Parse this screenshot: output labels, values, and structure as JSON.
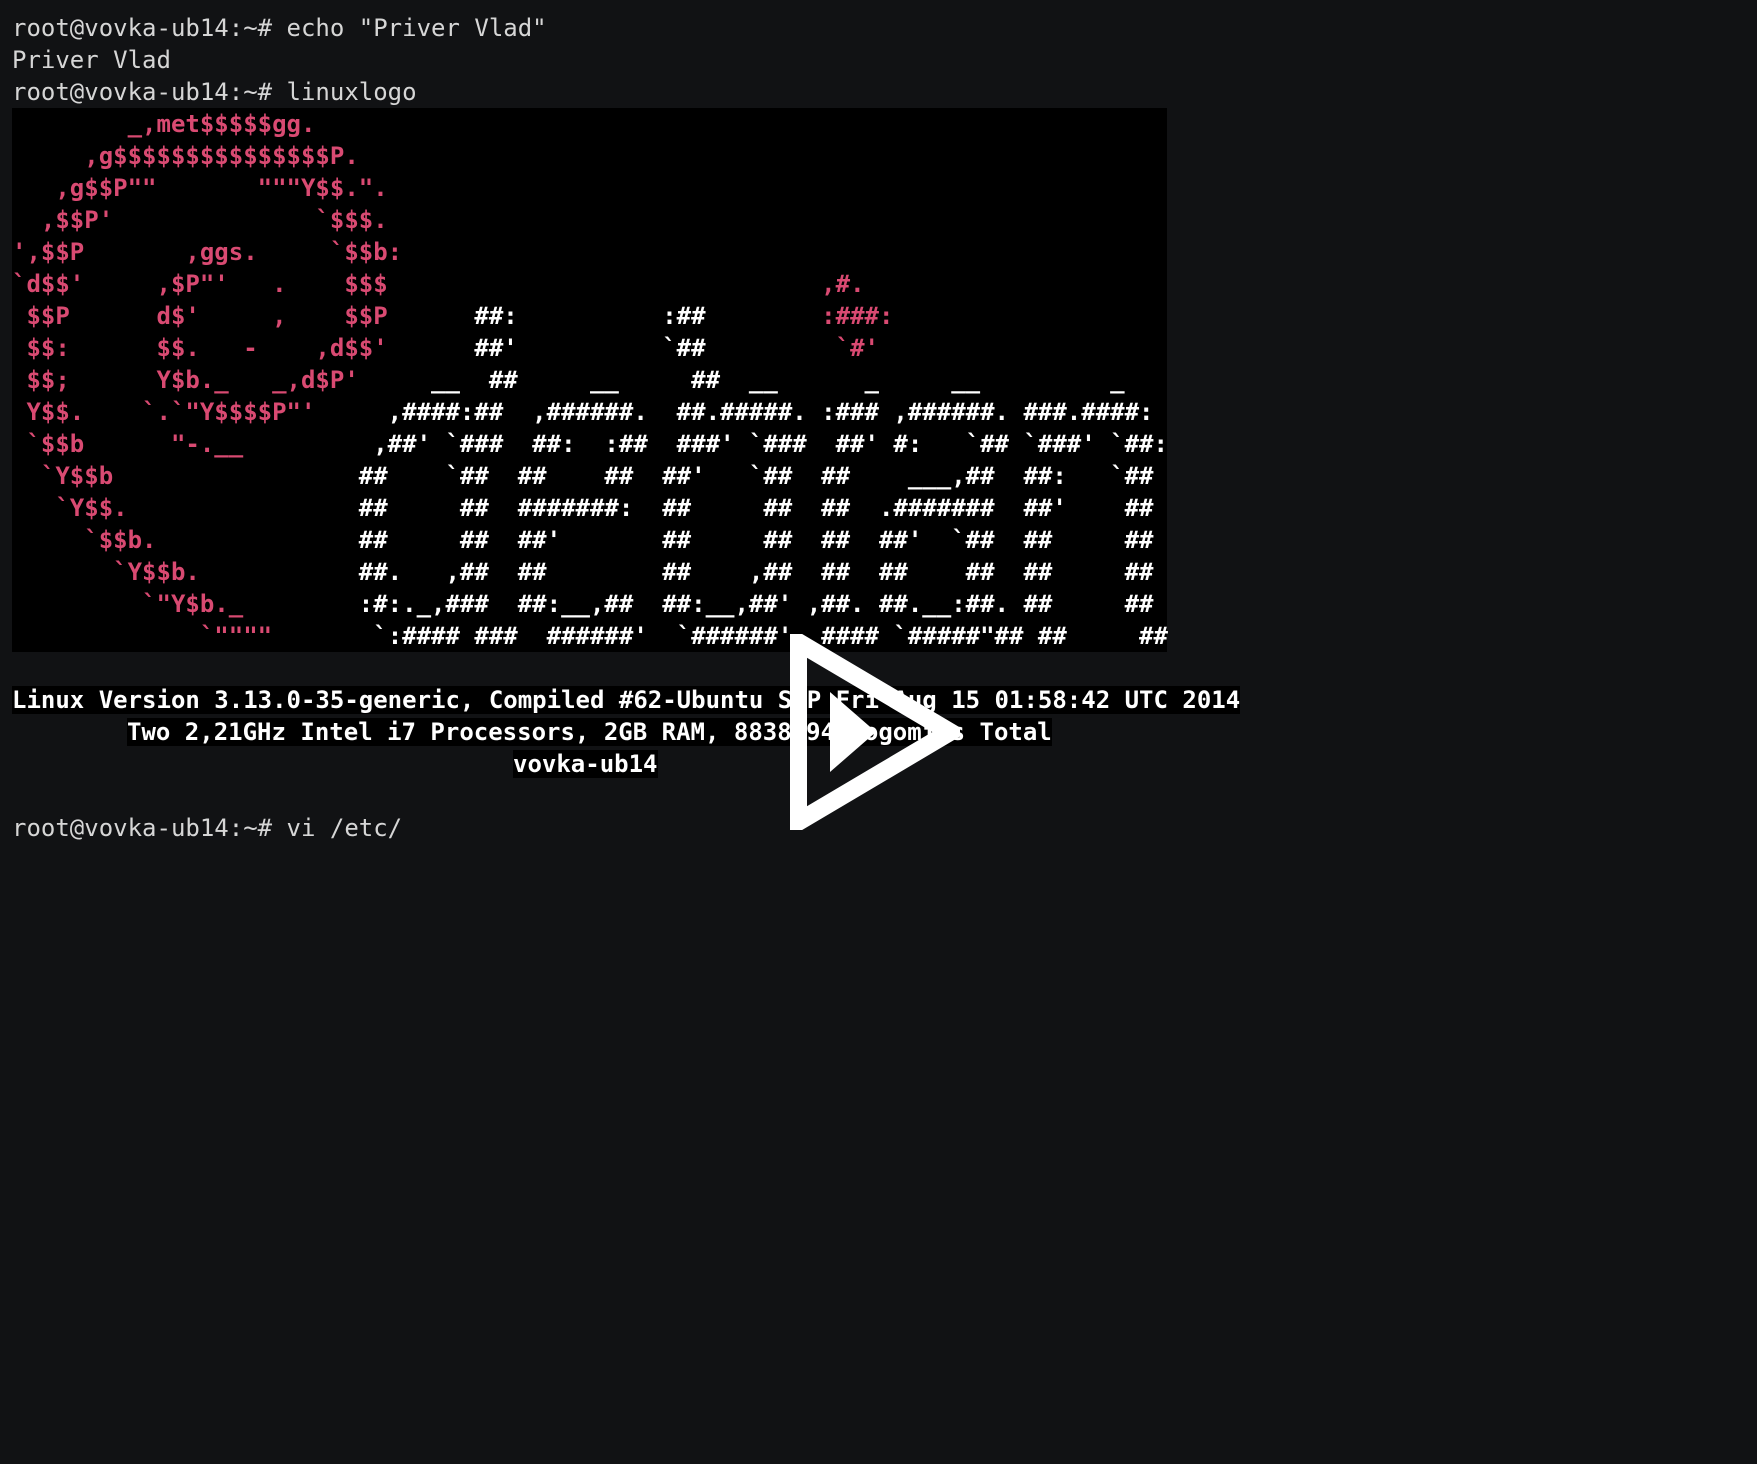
{
  "terminal": {
    "background": "#111214",
    "prompt": "root@vovka-ub14:~#",
    "lines": {
      "cmd1": "root@vovka-ub14:~# echo \"Priver Vlad\"",
      "out1": "Priver Vlad",
      "cmd2": "root@vovka-ub14:~# linuxlogo"
    },
    "logo": {
      "color_swirl": "#d94a72",
      "color_text": "#ffffff",
      "rows": [
        {
          "red": "        _,met$$$$$gg.",
          "white": ""
        },
        {
          "red": "     ,g$$$$$$$$$$$$$$$P.",
          "white": ""
        },
        {
          "red": "   ,g$$P\"\"       \"\"\"Y$$.\".",
          "white": ""
        },
        {
          "red": "  ,$$P'              `$$$.",
          "white": ""
        },
        {
          "red": "',$$P       ,ggs.     `$$b:",
          "white": ""
        },
        {
          "red": "`d$$'     ,$P\"'   .    $$$",
          "white": "",
          "red2": "                              ,#."
        },
        {
          "red": " $$P      d$'     ,    $$P",
          "white": "      ##:          :##        ",
          "red2": ":###:"
        },
        {
          "red": " $$:      $$.   -    ,d$$'",
          "white": "      ##'          `##         ",
          "red2": "`#'"
        },
        {
          "red": " $$;      Y$b._   _,d$P'",
          "white": "     __  ##     __     ##  __      _     __         _"
        },
        {
          "red": " Y$$.    `.`\"Y$$$$P\"'",
          "white": "     ,####:##  ,######.  ##.#####. :### ,######. ###.####:"
        },
        {
          "red": " `$$b      \"-.__",
          "white": "         ,##' `###  ##:  :##  ###' `###  ##' #:   `## `###' `##:"
        },
        {
          "red": "  `Y$$b",
          "white": "                 ##    `##  ##    ##  ##'   `##  ##    ___,##  ##:   `##"
        },
        {
          "red": "   `Y$$.",
          "white": "                ##     ##  #######:  ##     ##  ##  .#######  ##'    ##"
        },
        {
          "red": "     `$$b.",
          "white": "              ##     ##  ##'       ##     ##  ##  ##'  `##  ##     ##"
        },
        {
          "red": "       `Y$$b.",
          "white": "           ##.   ,##  ##        ##    ,##  ##  ##    ##  ##     ##"
        },
        {
          "red": "         `\"Y$b._",
          "white": "        :#:._,###  ##:__,##  ##:__,##' ,##. ##.__:##. ##     ##"
        },
        {
          "red": "             `\"\"\"\"",
          "white": "       `:#### ###  ######'  `######'  #### `#####\"## ##     ##"
        }
      ]
    },
    "info": {
      "version": "Linux Version 3.13.0-35-generic, Compiled #62-Ubuntu SMP Fri Aug 15 01:58:42 UTC 2014",
      "hardware": "Two 2,21GHz Intel i7 Processors, 2GB RAM, 8838.94 Bogomips Total",
      "hostname": "vovka-ub14"
    },
    "cmd3": "root@vovka-ub14:~# vi /etc/"
  },
  "overlay": {
    "icon": "play-icon",
    "color": "#ffffff"
  }
}
